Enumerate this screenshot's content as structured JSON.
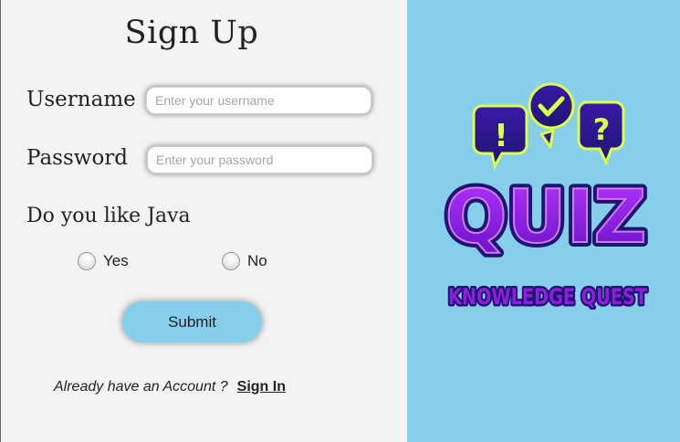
{
  "form": {
    "title": "Sign Up",
    "username": {
      "label": "Username",
      "placeholder": "Enter your username",
      "value": ""
    },
    "password": {
      "label": "Password",
      "placeholder": "Enter your password",
      "value": ""
    },
    "question": "Do you like Java",
    "options": [
      {
        "label": "Yes",
        "selected": false
      },
      {
        "label": "No",
        "selected": false
      }
    ],
    "submit_label": "Submit",
    "signin_prompt": "Already have an Account ?",
    "signin_link": "Sign In"
  },
  "logo": {
    "title": "QUIZ",
    "subtitle": "KNOWLEDGE QUEST",
    "bubbles": [
      "!",
      "?"
    ]
  },
  "colors": {
    "accent": "#87ceeb",
    "form_background": "#f3f3f3",
    "logo_purple": "#8e1fd8",
    "logo_navy": "#1e1474",
    "logo_glow": "#d9ff4a"
  }
}
